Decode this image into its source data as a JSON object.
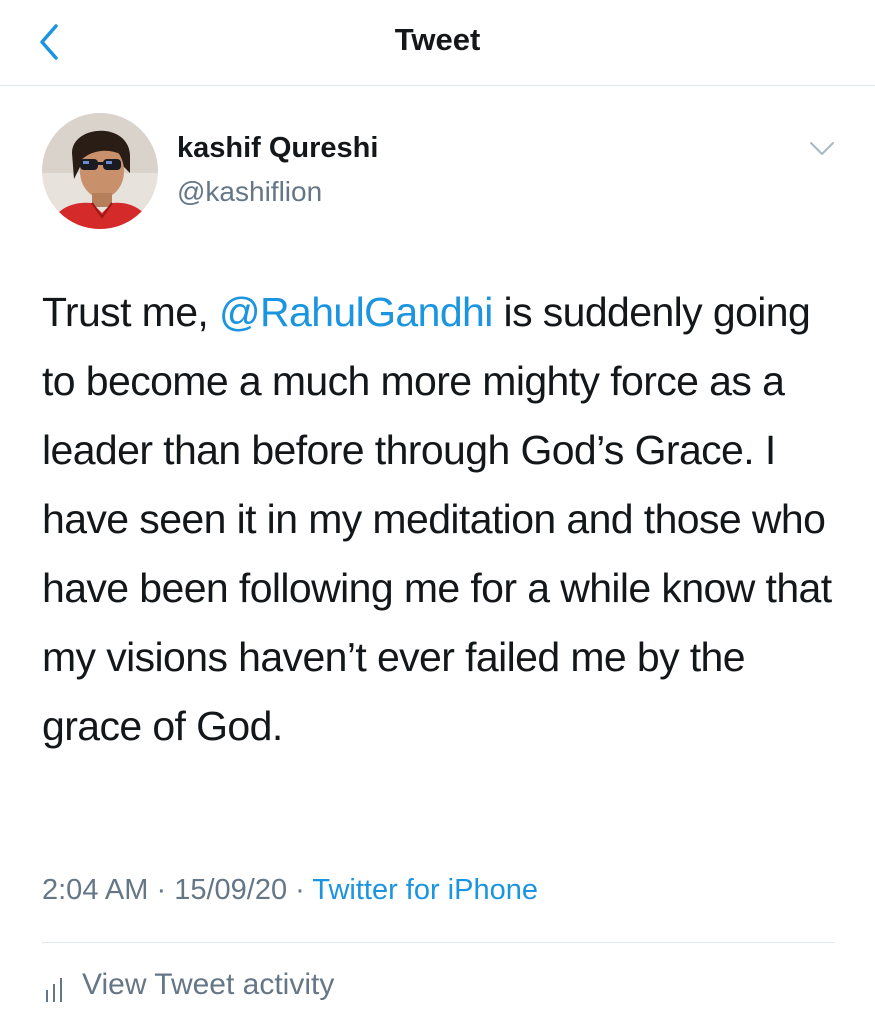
{
  "nav": {
    "title": "Tweet",
    "back_icon": "chevron-left-icon"
  },
  "colors": {
    "accent": "#1b95e0",
    "secondary_text": "#657786",
    "primary_text": "#14171a",
    "divider": "#e1e8ed"
  },
  "tweet": {
    "author": {
      "name": "kashif Qureshi",
      "handle": "@kashiflion",
      "avatar_icon": "profile-photo"
    },
    "menu_icon": "chevron-down-icon",
    "text_before": "Trust me, ",
    "mention": "@RahulGandhi",
    "text_after": " is suddenly going to become a much more mighty force as a leader than before through God’s Grace. I have seen it in my meditation and those who have been following me for a while know that my visions haven’t ever failed me by the grace of God.",
    "time": "2:04 AM",
    "date": "15/09/20",
    "separator": " · ",
    "source": "Twitter for iPhone"
  },
  "activity": {
    "icon": "bar-chart-icon",
    "label": "View Tweet activity"
  }
}
